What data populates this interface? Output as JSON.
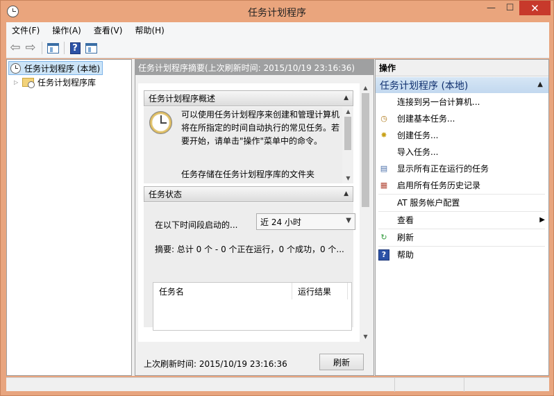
{
  "window": {
    "title": "任务计划程序",
    "minimize": "—",
    "maximize": "☐",
    "close": "✕"
  },
  "menu": [
    {
      "label": "文件(F)"
    },
    {
      "label": "操作(A)"
    },
    {
      "label": "查看(V)"
    },
    {
      "label": "帮助(H)"
    }
  ],
  "tree": {
    "root_label": "任务计划程序 (本地)",
    "library_label": "任务计划程序库"
  },
  "middle": {
    "header": "任务计划程序摘要(上次刷新时间: 2015/10/19 23:16:36)",
    "overview_title": "任务计划程序概述",
    "overview_text": "可以使用任务计划程序来创建和管理计算机将在所指定的时间自动执行的常见任务。若要开始，请单击\"操作\"菜单中的命令。",
    "overview_text2": "任务存储在任务计划程序库的文件夹",
    "status_title": "任务状态",
    "status_label": "在以下时间段启动的...",
    "status_select": "近 24 小时",
    "summary": "摘要: 总计 0 个 - 0 个正在运行，0 个成功，0 个...",
    "table_columns": [
      "任务名",
      "运行结果"
    ],
    "footer_text": "上次刷新时间: 2015/10/19 23:16:36",
    "refresh_button": "刷新"
  },
  "actions": {
    "title": "操作",
    "group": "任务计划程序 (本地)",
    "items": [
      {
        "label": "连接到另一台计算机...",
        "icon": "none"
      },
      {
        "label": "创建基本任务...",
        "icon": "basic-task-icon"
      },
      {
        "label": "创建任务...",
        "icon": "create-task-icon"
      },
      {
        "label": "导入任务...",
        "icon": "none"
      },
      {
        "label": "显示所有正在运行的任务",
        "icon": "running-tasks-icon"
      },
      {
        "label": "启用所有任务历史记录",
        "icon": "history-icon"
      },
      {
        "label": "AT 服务帐户配置",
        "icon": "none"
      },
      {
        "label": "查看",
        "icon": "none"
      },
      {
        "label": "刷新",
        "icon": "refresh-icon"
      },
      {
        "label": "帮助",
        "icon": "help-icon"
      }
    ]
  },
  "colors": {
    "title_bar": "#eaa57d",
    "selection": "#cce4f7",
    "actions_group": "#c2d8ef",
    "header": "#9fa0a1"
  }
}
